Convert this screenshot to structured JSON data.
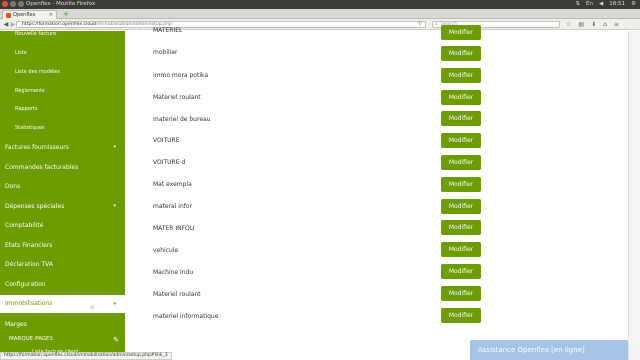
{
  "os": {
    "window_title": "Openflex - Mozilla Firefox",
    "clock": "18:51"
  },
  "browser": {
    "tab_title": "Openflex",
    "tab_close": "×",
    "new_tab": "+",
    "url_host": "https://formation.openflex.cloud",
    "url_path": "/immobilisation/admin/setup.php",
    "search_placeholder": "Search",
    "status_url": "https://formation.openflex.cloud/immobilisation/admin/setup.php#link_3"
  },
  "sidebar": {
    "top_sub": [
      "Nouvelle facture",
      "Liste",
      "Liste des modèles",
      "Règlements",
      "Rapports",
      "Statistiques"
    ],
    "main_items": [
      {
        "label": "Factures fournisseurs",
        "caret": "▾"
      },
      {
        "label": "Commandes facturables",
        "caret": ""
      },
      {
        "label": "Dons",
        "caret": ""
      },
      {
        "label": "Dépenses spéciales",
        "caret": "▾"
      },
      {
        "label": "Comptabilité",
        "caret": ""
      },
      {
        "label": "Etats Financiers",
        "caret": ""
      },
      {
        "label": "Déclaration TVA",
        "caret": ""
      },
      {
        "label": "Configuration",
        "caret": ""
      }
    ],
    "active_item": {
      "label": "Immobilisations",
      "caret": "▾"
    },
    "after_items": [
      "Marges",
      "MARQUE-PAGES",
      "Liste facture client"
    ]
  },
  "table": {
    "partial_top_label": "MATERIEL",
    "rows": [
      "mobilier",
      "immo mora potika",
      "Materiel roulant",
      "materiel de bureau",
      "VOITURE",
      "VOITURE d",
      "Mat exempla",
      "materal infor",
      "MATER INFOU",
      "vehicule",
      "Machine Indu",
      "Materiel roulant",
      "materiel informatique"
    ],
    "button_label": "Modifier"
  },
  "assist": {
    "label": "Assistance Openflex [en ligne]"
  },
  "colors": {
    "accent": "#6c9c00",
    "assist": "#a4c4e8"
  }
}
